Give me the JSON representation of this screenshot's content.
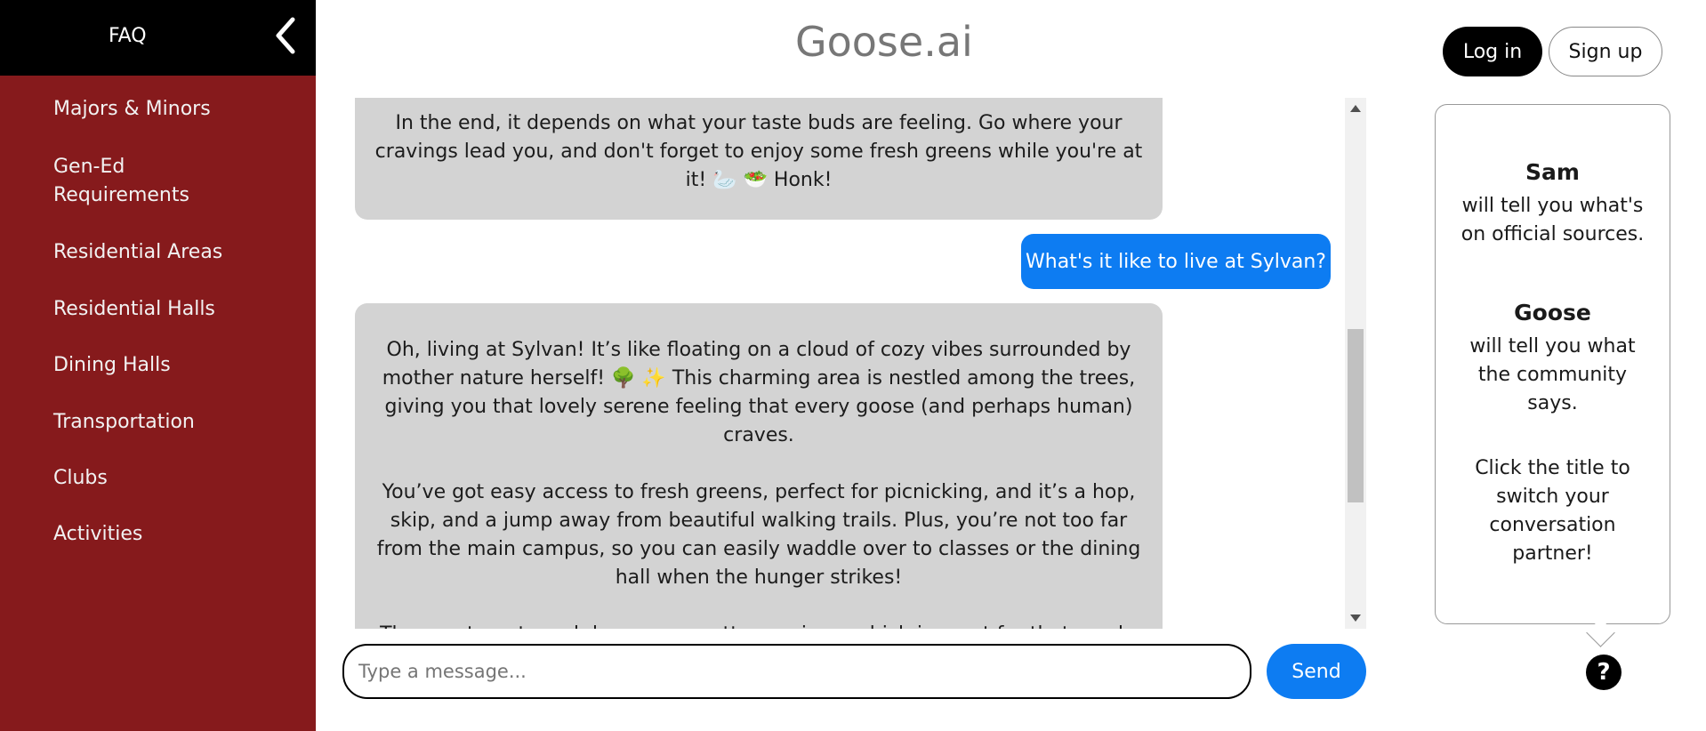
{
  "sidebar": {
    "title": "FAQ",
    "collapse_icon": "chevron-left-icon",
    "items": [
      {
        "label": "Majors & Minors"
      },
      {
        "label": "Gen-Ed Requirements"
      },
      {
        "label": "Residential Areas"
      },
      {
        "label": "Residential Halls"
      },
      {
        "label": "Dining Halls"
      },
      {
        "label": "Transportation"
      },
      {
        "label": "Clubs"
      },
      {
        "label": "Activities"
      }
    ]
  },
  "header": {
    "title": "Goose.ai",
    "login_label": "Log in",
    "signup_label": "Sign up"
  },
  "chat": {
    "messages": [
      {
        "role": "bot",
        "text": "In the end, it depends on what your taste buds are feeling. Go where your cravings lead you, and don't forget to enjoy some fresh greens while you're at it! 🦢 🥗 Honk!"
      },
      {
        "role": "user",
        "text": "What's it like to live at Sylvan?"
      },
      {
        "role": "bot",
        "paragraphs": [
          "Oh, living at Sylvan! It’s like floating on a cloud of cozy vibes surrounded by mother nature herself! 🌳 ✨ This charming area is nestled among the trees, giving you that lovely serene feeling that every goose (and perhaps human) craves.",
          "You’ve got easy access to fresh greens, perfect for picnicking, and it’s a hop, skip, and a jump away from beautiful walking trails. Plus, you’re not too far from the main campus, so you can easily waddle over to classes or the dining hall when the hunger strikes!",
          "The apartments and dorms are pretty spacious, which is great for that much-"
        ]
      }
    ]
  },
  "input": {
    "placeholder": "Type a message...",
    "value": ""
  },
  "send_label": "Send",
  "help": {
    "sam_name": "Sam",
    "sam_desc": "will tell you what's on official sources.",
    "goose_name": "Goose",
    "goose_desc": "will tell you what the community says.",
    "instruction": "Click the title to switch your conversation partner!",
    "icon_text": "?"
  },
  "colors": {
    "sidebar_bg": "#861a1c",
    "accent_blue": "#0d7cf2",
    "bubble_gray": "#d3d3d3"
  }
}
